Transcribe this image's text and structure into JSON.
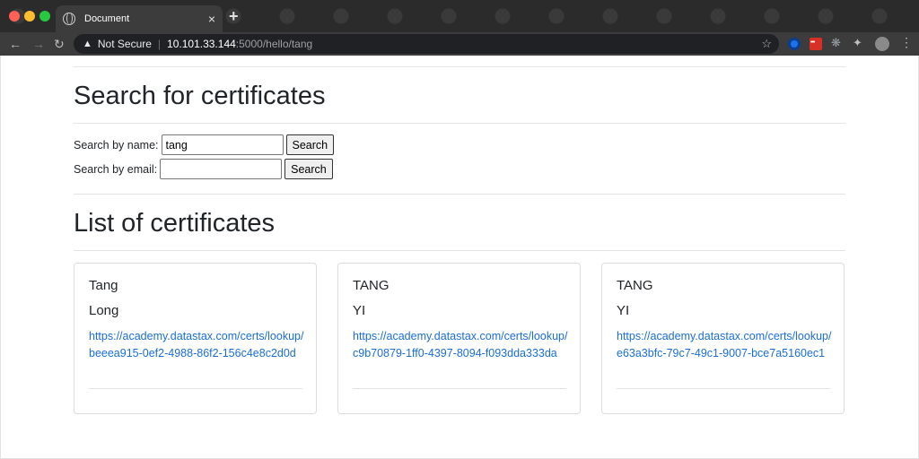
{
  "browser": {
    "tab_title": "Document",
    "tab_close": "×",
    "new_tab": "+",
    "security_label": "Not Secure",
    "url_host": "10.101.33.144",
    "url_rest": ":5000/hello/tang",
    "url_separator": "|"
  },
  "page": {
    "search_heading": "Search for certificates",
    "name_label": "Search by name:",
    "name_value": "tang",
    "name_button": "Search",
    "email_label": "Search by email:",
    "email_value": "",
    "email_button": "Search",
    "list_heading": "List of certificates",
    "certificates": [
      {
        "first_name": "Tang",
        "last_name": "Long",
        "link": "https://academy.datastax.com/certs/lookup/beeea915-0ef2-4988-86f2-156c4e8c2d0d"
      },
      {
        "first_name": "TANG",
        "last_name": "YI",
        "link": "https://academy.datastax.com/certs/lookup/c9b70879-1ff0-4397-8094-f093dda333da"
      },
      {
        "first_name": "TANG",
        "last_name": "YI",
        "link": "https://academy.datastax.com/certs/lookup/e63a3bfc-79c7-49c1-9007-bce7a5160ec1"
      }
    ]
  },
  "colors": {
    "link": "#1a6ed8",
    "text": "#212529",
    "chrome_dark": "#3c3c3c"
  },
  "icons": [
    "globe-icon",
    "back-arrow-icon",
    "forward-arrow-icon",
    "reload-icon",
    "warning-icon",
    "star-icon",
    "puzzle-icon",
    "profile-avatar"
  ]
}
